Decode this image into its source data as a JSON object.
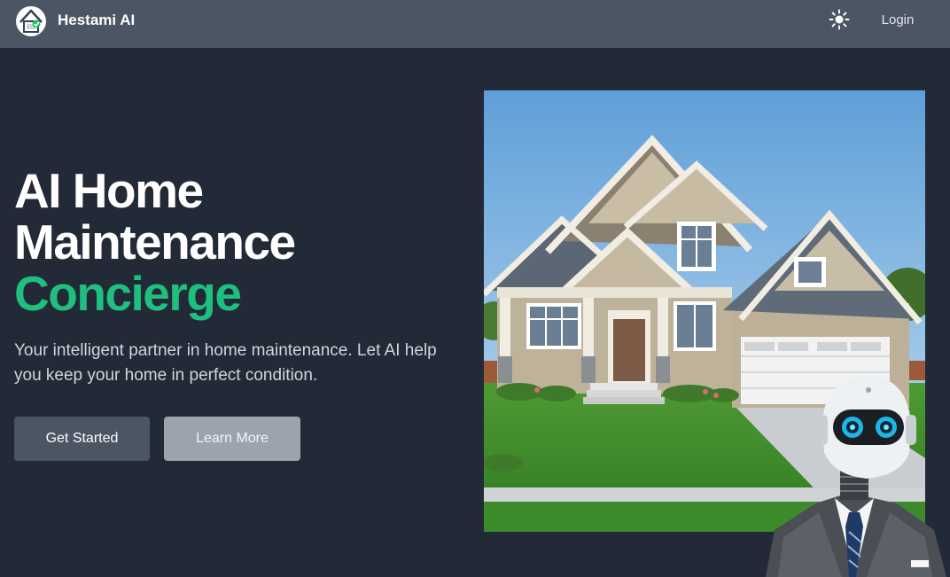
{
  "nav": {
    "brand": "Hestami AI",
    "login_label": "Login",
    "theme_icon": "sun-icon"
  },
  "hero": {
    "title_line1": "AI Home",
    "title_line2": "Maintenance",
    "title_accent": "Concierge",
    "subtitle": "Your intelligent partner in home maintenance. Let AI help you keep your home in perfect condition.",
    "primary_button": "Get Started",
    "secondary_button": "Learn More"
  },
  "colors": {
    "background": "#222a37",
    "navbar": "#4b5563",
    "accent": "#1fbf7f"
  }
}
